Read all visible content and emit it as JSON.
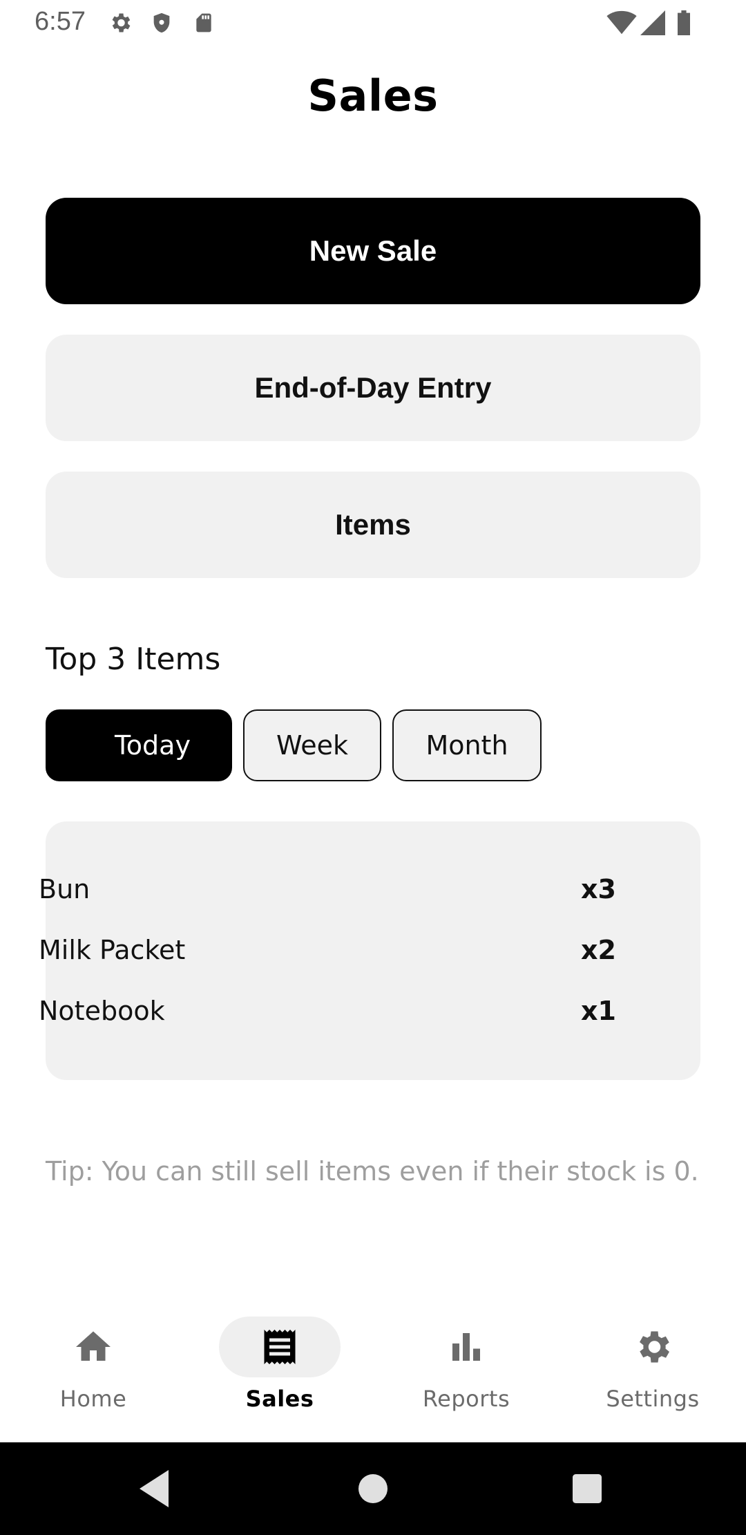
{
  "status_bar": {
    "time": "6:57",
    "left_icons": [
      "gear-icon",
      "shield-icon",
      "sd-card-icon"
    ],
    "right_icons": [
      "wifi-icon",
      "cell-signal-icon",
      "battery-icon"
    ]
  },
  "page": {
    "title": "Sales"
  },
  "actions": {
    "new_sale": "New Sale",
    "end_of_day": "End-of-Day Entry",
    "items": "Items"
  },
  "top_items": {
    "title": "Top 3 Items",
    "filters": [
      "Today",
      "Week",
      "Month"
    ],
    "selected_filter": "Today",
    "rows": [
      {
        "name": "Bun",
        "qty": "x3"
      },
      {
        "name": "Milk Packet",
        "qty": "x2"
      },
      {
        "name": "Notebook",
        "qty": "x1"
      }
    ]
  },
  "tip": "Tip: You can still sell items even if their stock is 0.",
  "bottom_nav": {
    "items": [
      {
        "label": "Home",
        "icon": "home-icon"
      },
      {
        "label": "Sales",
        "icon": "receipt-icon"
      },
      {
        "label": "Reports",
        "icon": "bar-chart-icon"
      },
      {
        "label": "Settings",
        "icon": "gear-icon"
      }
    ],
    "active": "Sales"
  },
  "colors": {
    "primary": "#000000",
    "surface": "#f1f1f1",
    "muted_text": "#9e9e9e",
    "nav_inactive": "#6b6b6b"
  }
}
